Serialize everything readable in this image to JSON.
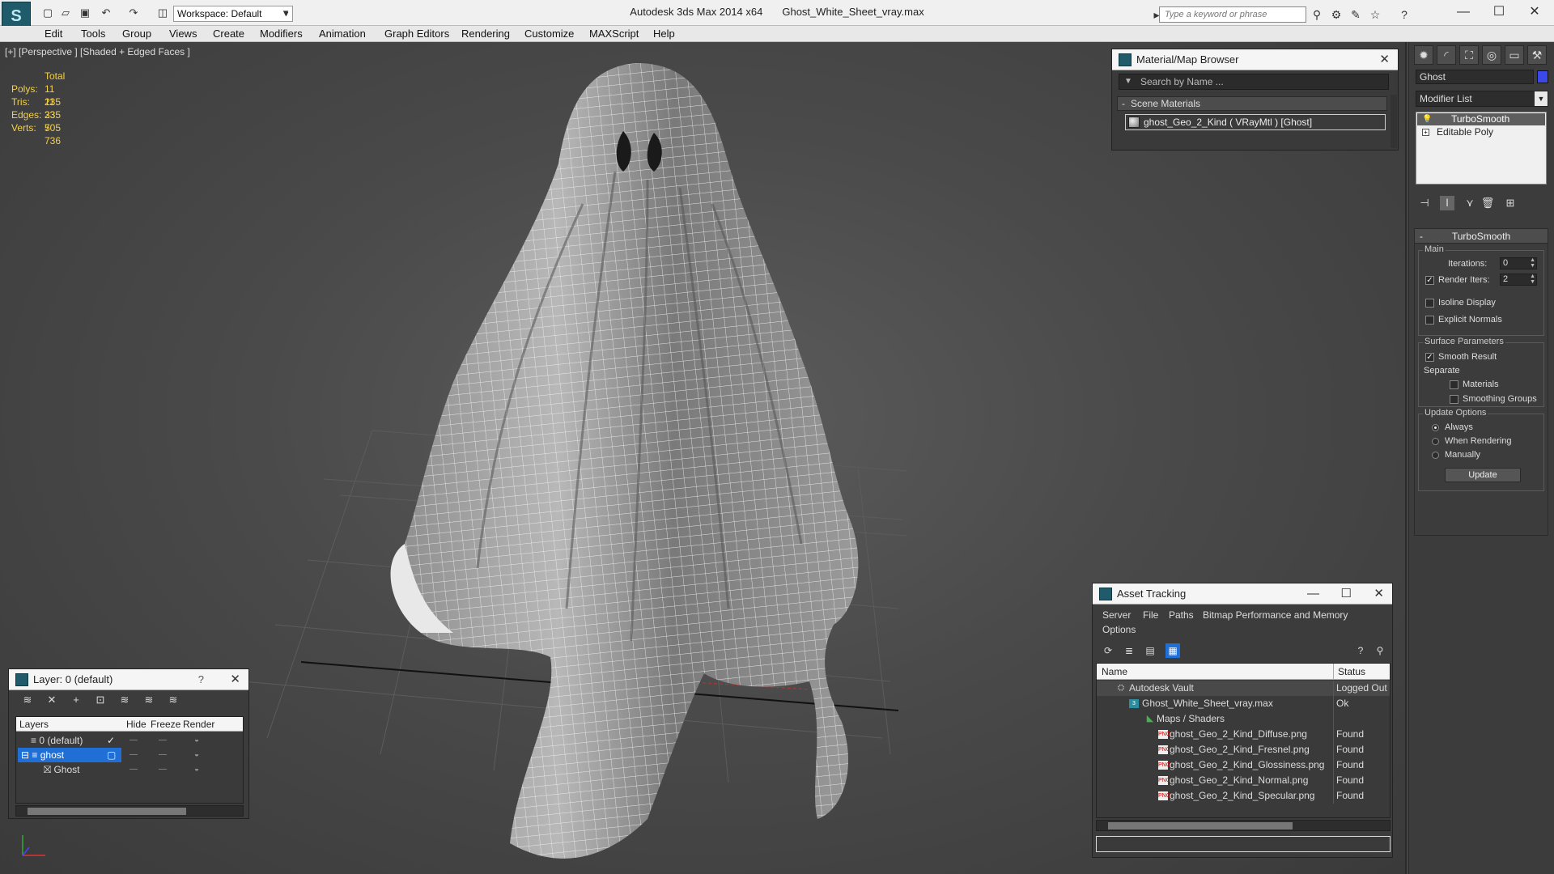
{
  "titlebar": {
    "workspace": "Workspace: Default",
    "app_name": "Autodesk 3ds Max  2014 x64",
    "file_name": "Ghost_White_Sheet_vray.max",
    "search_placeholder": "Type a keyword or phrase"
  },
  "menu": [
    "Edit",
    "Tools",
    "Group",
    "Views",
    "Create",
    "Modifiers",
    "Animation",
    "Graph Editors",
    "Rendering",
    "Customize",
    "MAXScript",
    "Help"
  ],
  "viewport": {
    "label": "[+] [Perspective ] [Shaded + Edged Faces ]",
    "stats": {
      "total_label": "Total",
      "rows": [
        {
          "key": "Polys:",
          "value": "11 235"
        },
        {
          "key": "Tris:",
          "value": "11 235"
        },
        {
          "key": "Edges:",
          "value": "33 705"
        },
        {
          "key": "Verts:",
          "value": "5 736"
        }
      ]
    }
  },
  "material_browser": {
    "title": "Material/Map Browser",
    "search_placeholder": "Search by Name ...",
    "section": "Scene Materials",
    "item": "ghost_Geo_2_Kind  ( VRayMtl )  [Ghost]"
  },
  "command_panel": {
    "object_name": "Ghost",
    "object_color": "#3a49e8",
    "modifier_list": "Modifier List",
    "stack": [
      "TurboSmooth",
      "Editable Poly"
    ],
    "turbosmooth": {
      "title": "TurboSmooth",
      "main_group": "Main",
      "iterations_label": "Iterations:",
      "iterations_value": "0",
      "render_iters_label": "Render Iters:",
      "render_iters_value": "2",
      "isoline_display": "Isoline Display",
      "explicit_normals": "Explicit Normals",
      "surface_group": "Surface Parameters",
      "smooth_result": "Smooth Result",
      "separate_label": "Separate",
      "materials": "Materials",
      "smoothing_groups": "Smoothing Groups",
      "update_group": "Update Options",
      "always": "Always",
      "when_rendering": "When Rendering",
      "manually": "Manually",
      "update_button": "Update"
    }
  },
  "layer_panel": {
    "title": "Layer: 0 (default)",
    "help": "?",
    "columns": [
      "Layers",
      "Hide",
      "Freeze",
      "Render"
    ],
    "rows": [
      {
        "name": "0 (default)"
      },
      {
        "name": "ghost"
      },
      {
        "name": "Ghost"
      }
    ]
  },
  "asset_tracking": {
    "title": "Asset Tracking",
    "menu": [
      "Server",
      "File",
      "Paths",
      "Bitmap Performance and Memory",
      "Options"
    ],
    "columns": [
      "Name",
      "Status"
    ],
    "rows": [
      {
        "name": "Autodesk Vault",
        "status": "Logged Out"
      },
      {
        "name": "Ghost_White_Sheet_vray.max",
        "status": "Ok"
      },
      {
        "name": "Maps / Shaders",
        "status": ""
      },
      {
        "name": "ghost_Geo_2_Kind_Diffuse.png",
        "status": "Found"
      },
      {
        "name": "ghost_Geo_2_Kind_Fresnel.png",
        "status": "Found"
      },
      {
        "name": "ghost_Geo_2_Kind_Glossiness.png",
        "status": "Found"
      },
      {
        "name": "ghost_Geo_2_Kind_Normal.png",
        "status": "Found"
      },
      {
        "name": "ghost_Geo_2_Kind_Specular.png",
        "status": "Found"
      }
    ]
  }
}
